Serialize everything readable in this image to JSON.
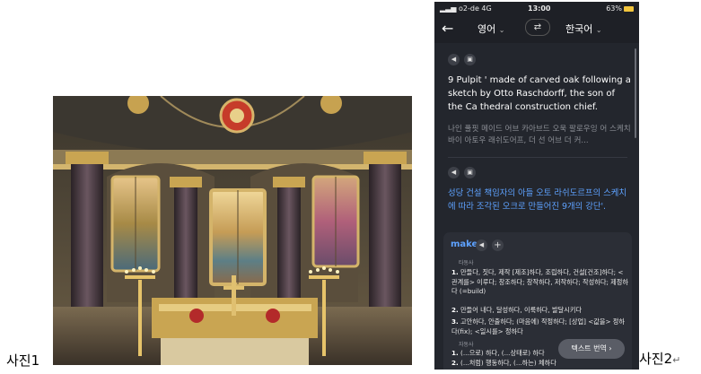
{
  "captions": {
    "photo1": "사진1",
    "photo2": "사진2",
    "return_mark": "↵"
  },
  "photo": {
    "subject": "cathedral altar with stained glass windows"
  },
  "phone": {
    "status": {
      "carrier": "o2-de  4G",
      "time": "13:00",
      "battery": "63%"
    },
    "header": {
      "source_lang": "영어",
      "target_lang": "한국어",
      "chevron": "⌄",
      "swap_icon": "⇄",
      "back_icon": "←"
    },
    "source_text": "9 Pulpit ' made of carved oak following a sketch by Otto Raschdorff, the son of the Ca thedral construction chief.",
    "transliteration": "나인 풀핏 메이드 어브 카아브드 오욱 팔로우잉 어 스케치 바이 아토우 래쉬도어프, 더 선 어브 더 커...",
    "target_text": "성당 건설 책임자의 아들 오토 라쉬도르프의 스케치에 따라 조각된 오크로 만들어진 9개의 강단'.",
    "dictionary": {
      "word": "make",
      "pos_transitive": "타동사",
      "pos_intransitive": "자동사",
      "senses": [
        {
          "num": "1.",
          "text": "만들다, 짓다, 제작 [제조]하다, 조립하다, 건설[건조]하다; <관계를> 이루다; 창조하다; 창작하다, 저작하다; 작성하다; 제정하다 (=build)"
        },
        {
          "num": "2.",
          "text": "만들어 내다, 달성하다, 이룩하다, 발달시키다"
        },
        {
          "num": "3.",
          "text": "고안하다, 안출하다; (마음에) 작정하다; [상업] <값을> 정하다(fix); <일시를> 정하다"
        }
      ],
      "intransitive_senses": [
        {
          "num": "1.",
          "text": "(...으로) 하다, (...상태로) 하다"
        },
        {
          "num": "2.",
          "text": "(...처럼) 행동하다, (...하는) 체하다"
        }
      ]
    },
    "translate_button": "텍스트 번역 ›"
  }
}
